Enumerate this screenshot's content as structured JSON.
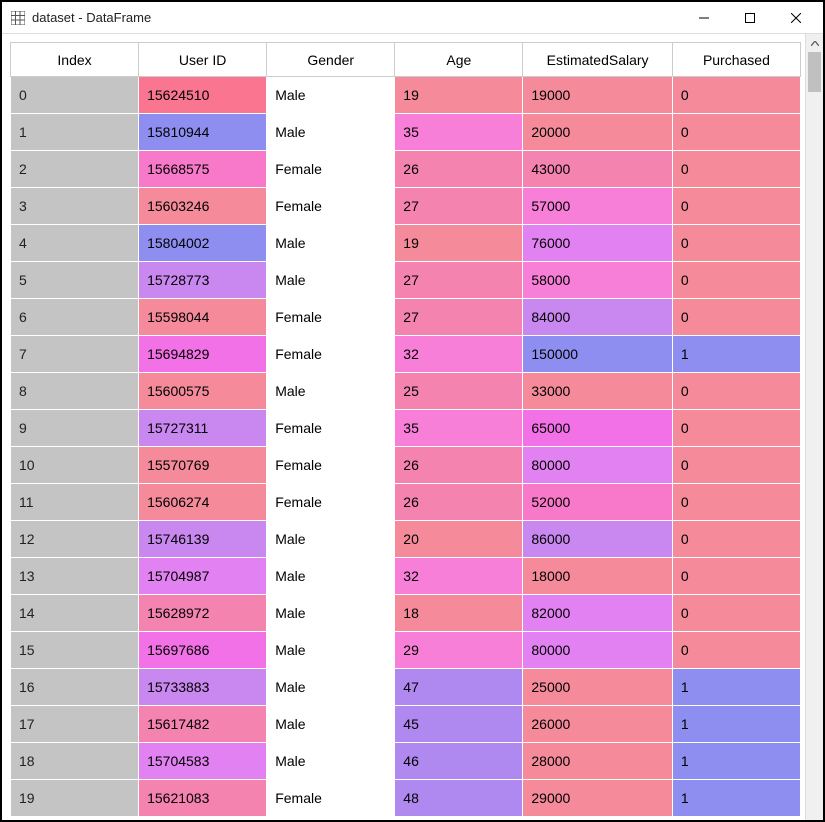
{
  "window": {
    "title": "dataset - DataFrame"
  },
  "columns": [
    "Index",
    "User ID",
    "Gender",
    "Age",
    "EstimatedSalary",
    "Purchased"
  ],
  "rows": [
    {
      "index": "0",
      "user_id": "15624510",
      "gender": "Male",
      "age": "19",
      "salary": "19000",
      "purchased": "0",
      "c_userid": "#f97590",
      "c_age": "#f48a9a",
      "c_salary": "#f48a9a",
      "c_purchased": "#f48a9a"
    },
    {
      "index": "1",
      "user_id": "15810944",
      "gender": "Male",
      "age": "35",
      "salary": "20000",
      "purchased": "0",
      "c_userid": "#8d8ef0",
      "c_age": "#f77fd7",
      "c_salary": "#f48a9a",
      "c_purchased": "#f48a9a"
    },
    {
      "index": "2",
      "user_id": "15668575",
      "gender": "Female",
      "age": "26",
      "salary": "43000",
      "purchased": "0",
      "c_userid": "#f879c9",
      "c_age": "#f583af",
      "c_salary": "#f583af",
      "c_purchased": "#f48a9a"
    },
    {
      "index": "3",
      "user_id": "15603246",
      "gender": "Female",
      "age": "27",
      "salary": "57000",
      "purchased": "0",
      "c_userid": "#f48a9a",
      "c_age": "#f583af",
      "c_salary": "#f77fd7",
      "c_purchased": "#f48a9a"
    },
    {
      "index": "4",
      "user_id": "15804002",
      "gender": "Male",
      "age": "19",
      "salary": "76000",
      "purchased": "0",
      "c_userid": "#8d8ef0",
      "c_age": "#f48a9a",
      "c_salary": "#e281f2",
      "c_purchased": "#f48a9a"
    },
    {
      "index": "5",
      "user_id": "15728773",
      "gender": "Male",
      "age": "27",
      "salary": "58000",
      "purchased": "0",
      "c_userid": "#c987f0",
      "c_age": "#f583af",
      "c_salary": "#f77fd7",
      "c_purchased": "#f48a9a"
    },
    {
      "index": "6",
      "user_id": "15598044",
      "gender": "Female",
      "age": "27",
      "salary": "84000",
      "purchased": "0",
      "c_userid": "#f48a9a",
      "c_age": "#f583af",
      "c_salary": "#c987f0",
      "c_purchased": "#f48a9a"
    },
    {
      "index": "7",
      "user_id": "15694829",
      "gender": "Female",
      "age": "32",
      "salary": "150000",
      "purchased": "1",
      "c_userid": "#f371e7",
      "c_age": "#f77fd7",
      "c_salary": "#8d8ef0",
      "c_purchased": "#8d8ef0"
    },
    {
      "index": "8",
      "user_id": "15600575",
      "gender": "Male",
      "age": "25",
      "salary": "33000",
      "purchased": "0",
      "c_userid": "#f48a9a",
      "c_age": "#f583af",
      "c_salary": "#f48a9a",
      "c_purchased": "#f48a9a"
    },
    {
      "index": "9",
      "user_id": "15727311",
      "gender": "Female",
      "age": "35",
      "salary": "65000",
      "purchased": "0",
      "c_userid": "#c987f0",
      "c_age": "#f77fd7",
      "c_salary": "#f371e7",
      "c_purchased": "#f48a9a"
    },
    {
      "index": "10",
      "user_id": "15570769",
      "gender": "Female",
      "age": "26",
      "salary": "80000",
      "purchased": "0",
      "c_userid": "#f48a9a",
      "c_age": "#f583af",
      "c_salary": "#e281f2",
      "c_purchased": "#f48a9a"
    },
    {
      "index": "11",
      "user_id": "15606274",
      "gender": "Female",
      "age": "26",
      "salary": "52000",
      "purchased": "0",
      "c_userid": "#f48a9a",
      "c_age": "#f583af",
      "c_salary": "#f879c9",
      "c_purchased": "#f48a9a"
    },
    {
      "index": "12",
      "user_id": "15746139",
      "gender": "Male",
      "age": "20",
      "salary": "86000",
      "purchased": "0",
      "c_userid": "#c987f0",
      "c_age": "#f48a9a",
      "c_salary": "#c987f0",
      "c_purchased": "#f48a9a"
    },
    {
      "index": "13",
      "user_id": "15704987",
      "gender": "Male",
      "age": "32",
      "salary": "18000",
      "purchased": "0",
      "c_userid": "#e281f2",
      "c_age": "#f77fd7",
      "c_salary": "#f48a9a",
      "c_purchased": "#f48a9a"
    },
    {
      "index": "14",
      "user_id": "15628972",
      "gender": "Male",
      "age": "18",
      "salary": "82000",
      "purchased": "0",
      "c_userid": "#f583af",
      "c_age": "#f48a9a",
      "c_salary": "#e281f2",
      "c_purchased": "#f48a9a"
    },
    {
      "index": "15",
      "user_id": "15697686",
      "gender": "Male",
      "age": "29",
      "salary": "80000",
      "purchased": "0",
      "c_userid": "#f371e7",
      "c_age": "#f77fd7",
      "c_salary": "#e281f2",
      "c_purchased": "#f48a9a"
    },
    {
      "index": "16",
      "user_id": "15733883",
      "gender": "Male",
      "age": "47",
      "salary": "25000",
      "purchased": "1",
      "c_userid": "#c987f0",
      "c_age": "#b089f0",
      "c_salary": "#f48a9a",
      "c_purchased": "#8d8ef0"
    },
    {
      "index": "17",
      "user_id": "15617482",
      "gender": "Male",
      "age": "45",
      "salary": "26000",
      "purchased": "1",
      "c_userid": "#f583af",
      "c_age": "#b089f0",
      "c_salary": "#f48a9a",
      "c_purchased": "#8d8ef0"
    },
    {
      "index": "18",
      "user_id": "15704583",
      "gender": "Male",
      "age": "46",
      "salary": "28000",
      "purchased": "1",
      "c_userid": "#e281f2",
      "c_age": "#b089f0",
      "c_salary": "#f48a9a",
      "c_purchased": "#8d8ef0"
    },
    {
      "index": "19",
      "user_id": "15621083",
      "gender": "Female",
      "age": "48",
      "salary": "29000",
      "purchased": "1",
      "c_userid": "#f583af",
      "c_age": "#b089f0",
      "c_salary": "#f48a9a",
      "c_purchased": "#8d8ef0"
    }
  ]
}
